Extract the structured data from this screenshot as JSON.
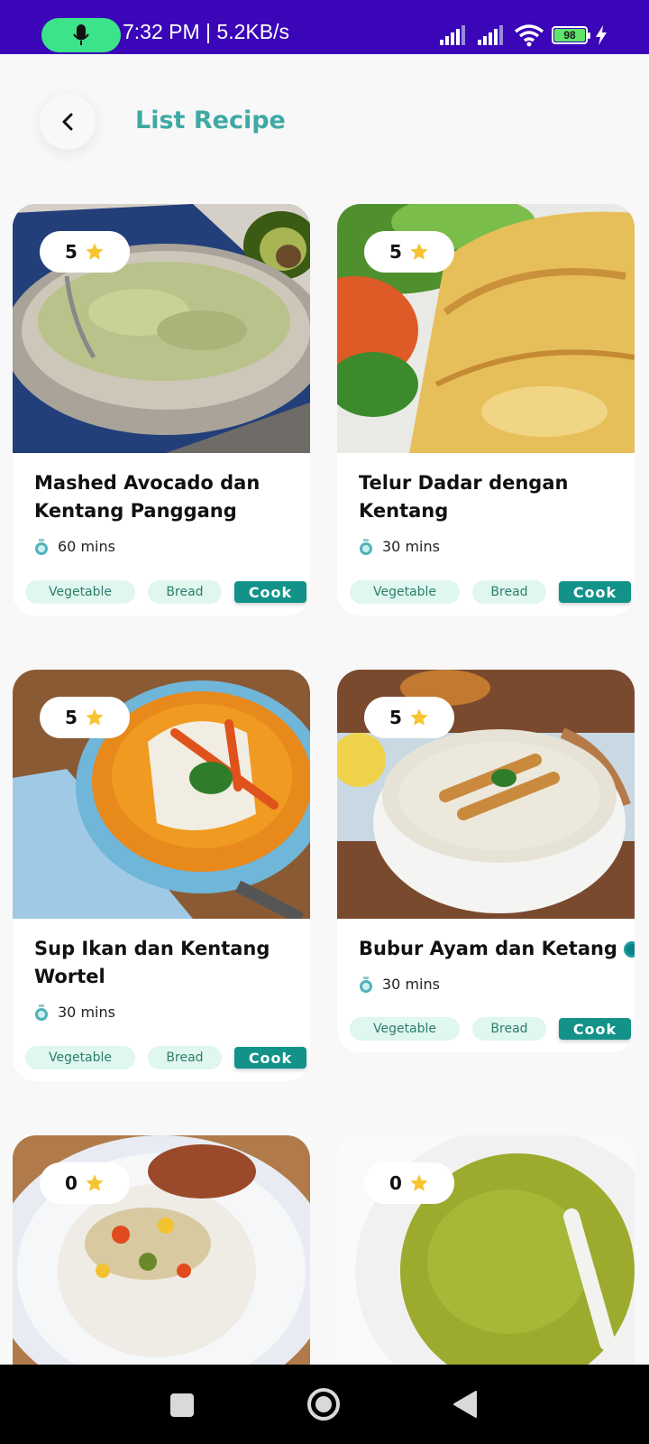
{
  "status_bar": {
    "text": "7:32 PM | 5.2KB/s",
    "battery": "98",
    "icons": [
      "mic-icon",
      "signal-icon",
      "signal-icon",
      "wifi-icon",
      "battery-icon",
      "charging-icon"
    ]
  },
  "header": {
    "title": "List Recipe",
    "back_icon": "chevron-left-icon"
  },
  "colors": {
    "status_bar": "#3a06b7",
    "accent": "#3fa9a4",
    "cook_button": "#139289",
    "tag_bg": "#dff7ee",
    "star": "#f6c430"
  },
  "recipes": [
    {
      "rating": "5",
      "title_line1": "Mashed Avocado dan",
      "title_line2": "Kentang Panggang",
      "time": "60 mins",
      "tags": [
        "Vegetable",
        "Bread"
      ],
      "action": "Cook"
    },
    {
      "rating": "5",
      "title_line1": "Telur Dadar dengan",
      "title_line2": "Kentang",
      "time": "30 mins",
      "tags": [
        "Vegetable",
        "Bread"
      ],
      "action": "Cook"
    },
    {
      "rating": "5",
      "title_line1": "Sup Ikan dan Kentang",
      "title_line2": "Wortel",
      "time": "30 mins",
      "tags": [
        "Vegetable",
        "Bread"
      ],
      "action": "Cook"
    },
    {
      "rating": "5",
      "title_line1": "Bubur Ayam dan Ketang",
      "title_line2": "",
      "time": "30 mins",
      "tags": [
        "Vegetable",
        "Bread"
      ],
      "action": "Cook"
    },
    {
      "rating": "0"
    },
    {
      "rating": "0"
    }
  ],
  "nav_bar": {
    "icons": [
      "recents-icon",
      "home-icon",
      "back-icon"
    ]
  }
}
